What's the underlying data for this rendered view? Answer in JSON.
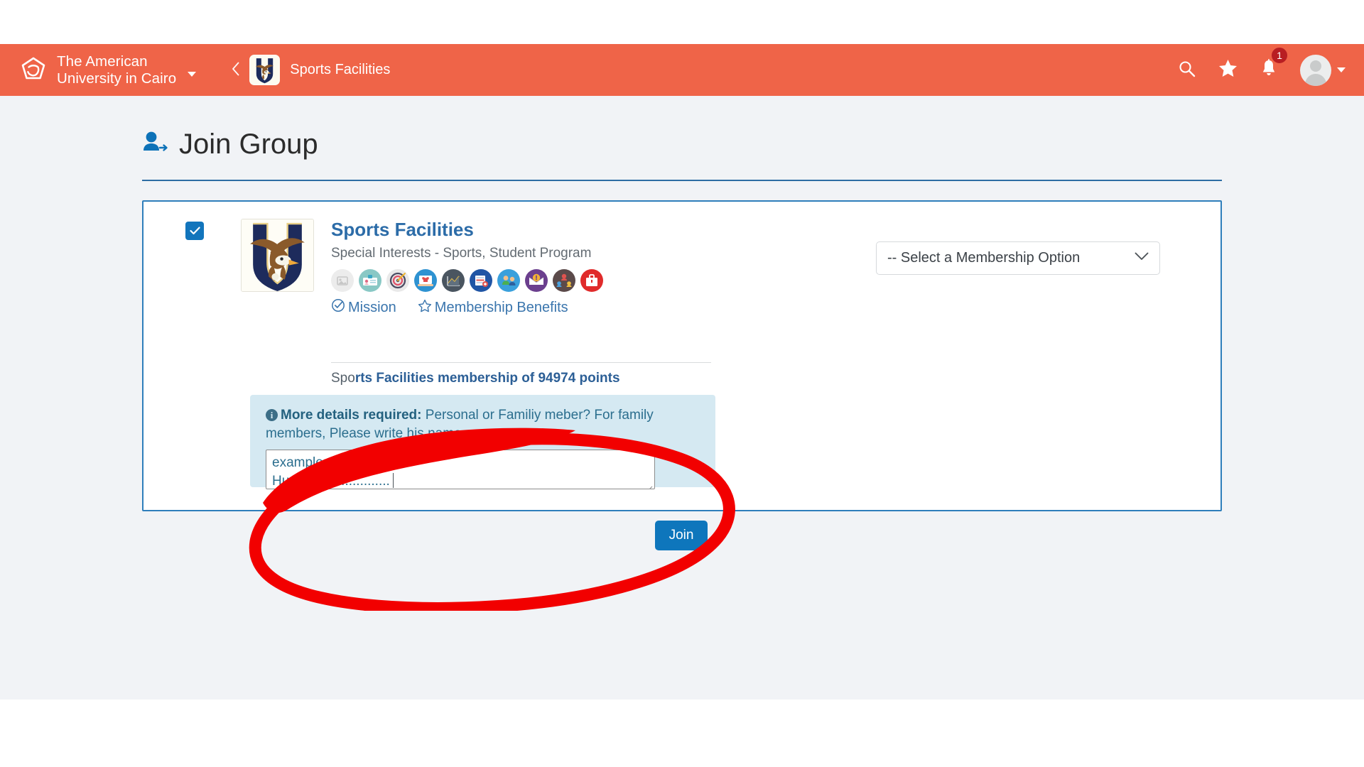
{
  "navbar": {
    "brand_text_line1": "The American",
    "brand_text_line2": "University in Cairo",
    "brand_icon": "auc-logo-icon",
    "brand_caret_icon": "chevron-down-icon",
    "back_icon": "chevron-left-icon",
    "app_logo_icon": "eagle-crest-icon",
    "app_title": "Sports Facilities",
    "search_icon": "search-icon",
    "favorites_icon": "star-icon",
    "notifications_icon": "bell-icon",
    "notification_count": "1",
    "avatar_icon": "avatar",
    "avatar_caret_icon": "chevron-down-icon",
    "background_color": "#ef6448"
  },
  "page": {
    "title": "Join Group",
    "title_icon": "person-add-icon",
    "accent_color": "#2d6da3",
    "background_color": "#f1f3f6"
  },
  "card": {
    "checkbox_checked": true,
    "checkbox_icon": "check-icon",
    "logo_icon": "eagle-crest-icon",
    "group_name": "Sports Facilities",
    "group_category": "Special Interests - Sports, Student Program",
    "badges": [
      {
        "name": "image-badge-icon",
        "color": "#ececec"
      },
      {
        "name": "id-card-badge-icon",
        "color": "#89c8c5"
      },
      {
        "name": "target-badge-icon",
        "color": "#e9e9e9"
      },
      {
        "name": "jersey-badge-icon",
        "color": "#2e92d1"
      },
      {
        "name": "chart-badge-icon",
        "color": "#4a5560"
      },
      {
        "name": "spreadsheet-badge-icon",
        "color": "#2055a5"
      },
      {
        "name": "people-badge-icon",
        "color": "#3aa0dc"
      },
      {
        "name": "mail-badge-icon",
        "color": "#6b3f8e"
      },
      {
        "name": "org-chart-badge-icon",
        "color": "#5b4a4a"
      },
      {
        "name": "briefcase-badge-icon",
        "color": "#e02b2b"
      }
    ],
    "links": [
      {
        "label": "Mission",
        "icon": "check-circle-icon"
      },
      {
        "label": "Membership Benefits",
        "icon": "star-outline-icon"
      }
    ],
    "points_text_prefix": "Spo",
    "points_text_obscured": "rts Facilities membership of 94974 points",
    "border_color": "#2e7ebb"
  },
  "callout": {
    "info_icon": "info-icon",
    "heading": "More details required:",
    "body": " Personal or Familiy meber? For family members, Please write his name.",
    "textarea_value": "example:\nHusband, ...............",
    "textarea_line1": "example:",
    "textarea_line2": "Husband, ...............",
    "resize_icon": "resize-grip-icon",
    "background_color": "#d5e9f2",
    "text_color": "#2b6e8e"
  },
  "membership_select": {
    "selected_label": "-- Select a Membership Option",
    "chevron_icon": "chevron-down-icon"
  },
  "join_button": {
    "label": "Join",
    "color": "#0e76bc"
  },
  "annotation": {
    "shape": "hand-drawn-red-ellipse",
    "color": "#f20000"
  }
}
